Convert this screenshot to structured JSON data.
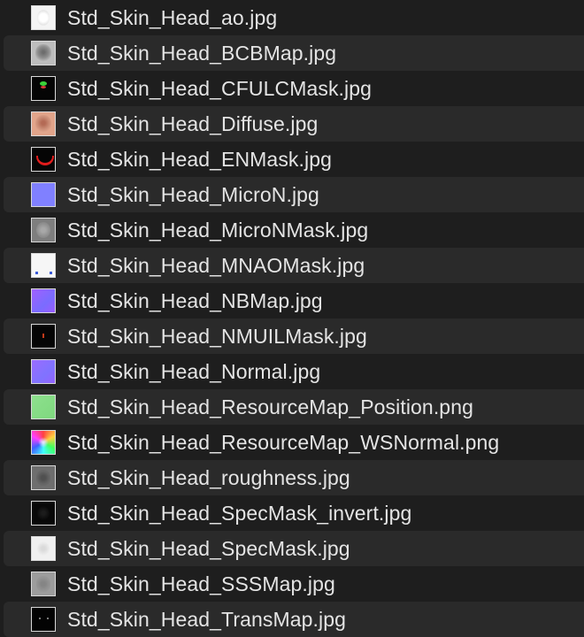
{
  "files": [
    {
      "name": "Std_Skin_Head_ao.jpg",
      "icon": "ao-thumbnail-icon"
    },
    {
      "name": "Std_Skin_Head_BCBMap.jpg",
      "icon": "bcbmap-thumbnail-icon"
    },
    {
      "name": "Std_Skin_Head_CFULCMask.jpg",
      "icon": "cfulcmask-thumbnail-icon"
    },
    {
      "name": "Std_Skin_Head_Diffuse.jpg",
      "icon": "diffuse-thumbnail-icon"
    },
    {
      "name": "Std_Skin_Head_ENMask.jpg",
      "icon": "enmask-thumbnail-icon"
    },
    {
      "name": "Std_Skin_Head_MicroN.jpg",
      "icon": "micron-thumbnail-icon"
    },
    {
      "name": "Std_Skin_Head_MicroNMask.jpg",
      "icon": "micronmask-thumbnail-icon"
    },
    {
      "name": "Std_Skin_Head_MNAOMask.jpg",
      "icon": "mnaomask-thumbnail-icon"
    },
    {
      "name": "Std_Skin_Head_NBMap.jpg",
      "icon": "nbmap-thumbnail-icon"
    },
    {
      "name": "Std_Skin_Head_NMUILMask.jpg",
      "icon": "nmuilmask-thumbnail-icon"
    },
    {
      "name": "Std_Skin_Head_Normal.jpg",
      "icon": "normal-thumbnail-icon"
    },
    {
      "name": "Std_Skin_Head_ResourceMap_Position.png",
      "icon": "position-map-thumbnail-icon"
    },
    {
      "name": "Std_Skin_Head_ResourceMap_WSNormal.png",
      "icon": "wsnormal-map-thumbnail-icon"
    },
    {
      "name": "Std_Skin_Head_roughness.jpg",
      "icon": "roughness-thumbnail-icon"
    },
    {
      "name": "Std_Skin_Head_SpecMask_invert.jpg",
      "icon": "specmask-invert-thumbnail-icon"
    },
    {
      "name": "Std_Skin_Head_SpecMask.jpg",
      "icon": "specmask-thumbnail-icon"
    },
    {
      "name": "Std_Skin_Head_SSSMap.jpg",
      "icon": "sssmap-thumbnail-icon"
    },
    {
      "name": "Std_Skin_Head_TransMap.jpg",
      "icon": "transmap-thumbnail-icon"
    }
  ],
  "colors": {
    "background": "#1e1e1e",
    "stripe": "#2a2a2a",
    "text": "#e4e4e4"
  }
}
